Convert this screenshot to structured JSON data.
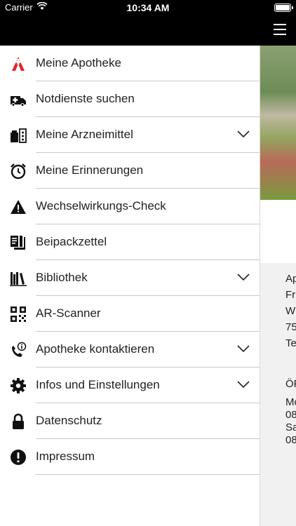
{
  "statusbar": {
    "carrier": "Carrier",
    "time": "10:34 AM"
  },
  "menu": [
    {
      "label": "Meine Apotheke",
      "icon": "pharmacy-logo-icon",
      "chevron": false
    },
    {
      "label": "Notdienste suchen",
      "icon": "ambulance-icon",
      "chevron": false
    },
    {
      "label": "Meine Arzneimittel",
      "icon": "medication-icon",
      "chevron": true
    },
    {
      "label": "Meine Erinnerungen",
      "icon": "alarm-clock-icon",
      "chevron": false
    },
    {
      "label": "Wechselwirkungs-Check",
      "icon": "warning-icon",
      "chevron": false
    },
    {
      "label": "Beipackzettel",
      "icon": "leaflet-icon",
      "chevron": false
    },
    {
      "label": "Bibliothek",
      "icon": "library-icon",
      "chevron": true
    },
    {
      "label": "AR-Scanner",
      "icon": "qr-code-icon",
      "chevron": false
    },
    {
      "label": "Apotheke kontaktieren",
      "icon": "phone-info-icon",
      "chevron": true
    },
    {
      "label": "Infos und Einstellungen",
      "icon": "gear-icon",
      "chevron": true
    },
    {
      "label": "Datenschutz",
      "icon": "lock-icon",
      "chevron": false
    },
    {
      "label": "Impressum",
      "icon": "exclamation-icon",
      "chevron": false
    }
  ],
  "background": {
    "address_lines": [
      "Ap",
      "Fri",
      "W",
      "75",
      "Te"
    ],
    "hours_heading": "ÖF",
    "hours_lines": [
      "Mo",
      "08",
      "Sa",
      "08"
    ]
  },
  "colors": {
    "accent": "#e2262a",
    "bar": "#000000"
  }
}
